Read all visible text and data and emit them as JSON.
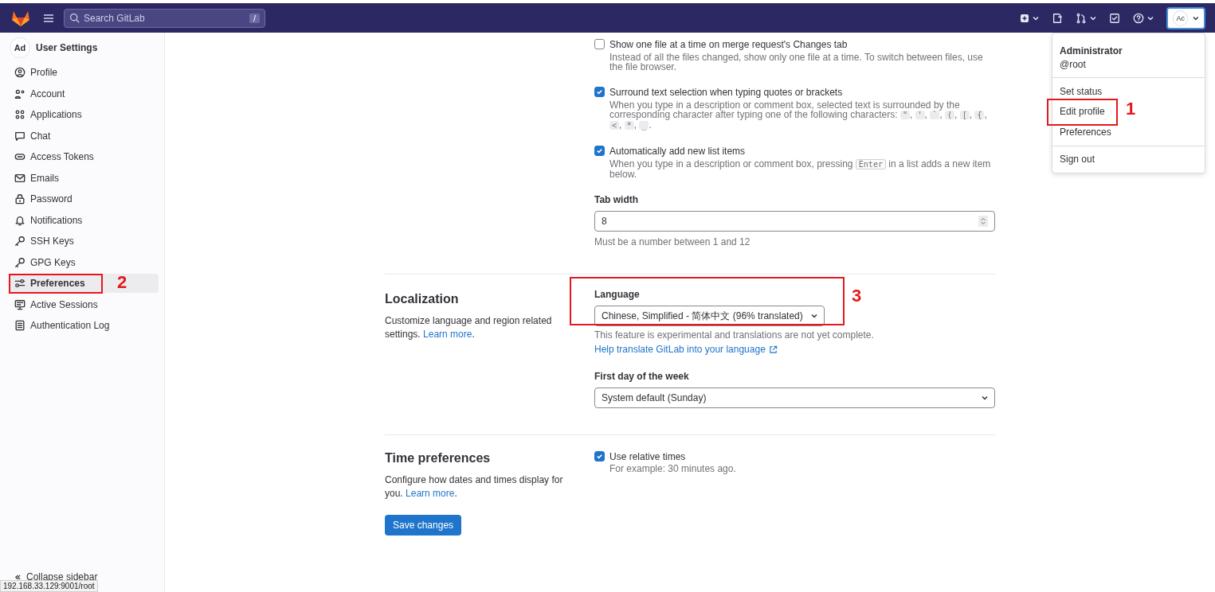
{
  "topbar": {
    "search_placeholder": "Search GitLab",
    "search_key": "/",
    "avatar": "Ac"
  },
  "user_menu": {
    "name": "Administrator",
    "handle": "@root",
    "groups": [
      [
        {
          "label": "Set status"
        },
        {
          "label": "Edit profile",
          "annotation": "1"
        },
        {
          "label": "Preferences"
        }
      ],
      [
        {
          "label": "Sign out"
        }
      ]
    ]
  },
  "sidebar": {
    "avatar": "Ad",
    "title": "User Settings",
    "items": [
      {
        "label": "Profile",
        "kind": "profile",
        "selected": false
      },
      {
        "label": "Account",
        "kind": "account",
        "selected": false
      },
      {
        "label": "Applications",
        "kind": "applications",
        "selected": false
      },
      {
        "label": "Chat",
        "kind": "chat",
        "selected": false
      },
      {
        "label": "Access Tokens",
        "kind": "token",
        "selected": false
      },
      {
        "label": "Emails",
        "kind": "mail",
        "selected": false
      },
      {
        "label": "Password",
        "kind": "lock",
        "selected": false
      },
      {
        "label": "Notifications",
        "kind": "bell",
        "selected": false
      },
      {
        "label": "SSH Keys",
        "kind": "key",
        "selected": false
      },
      {
        "label": "GPG Keys",
        "kind": "key",
        "selected": false
      },
      {
        "label": "Preferences",
        "kind": "preferences",
        "selected": true,
        "annotation": "2"
      },
      {
        "label": "Active Sessions",
        "kind": "monitor",
        "selected": false
      },
      {
        "label": "Authentication Log",
        "kind": "log",
        "selected": false
      }
    ],
    "collapse": "Collapse sidebar"
  },
  "behavior": {
    "options": [
      {
        "label": "Show one file at a time on merge request's Changes tab",
        "checked": false,
        "description": [
          {
            "kind": "text",
            "text": "Instead of all the files changed, show only one file at a time. To switch between files, use the file browser."
          }
        ]
      },
      {
        "label": "Surround text selection when typing quotes or brackets",
        "checked": true,
        "description": [
          {
            "kind": "text",
            "text": "When you type in a description or comment box, selected text is surrounded by the corresponding character after typing one of the following characters: "
          },
          {
            "kind": "code",
            "text": "\""
          },
          {
            "kind": "text",
            "text": ", "
          },
          {
            "kind": "code",
            "text": "'"
          },
          {
            "kind": "text",
            "text": ", "
          },
          {
            "kind": "code",
            "text": "`"
          },
          {
            "kind": "text",
            "text": ", "
          },
          {
            "kind": "code",
            "text": "("
          },
          {
            "kind": "text",
            "text": ", "
          },
          {
            "kind": "code",
            "text": "["
          },
          {
            "kind": "text",
            "text": ", "
          },
          {
            "kind": "code",
            "text": "{"
          },
          {
            "kind": "text",
            "text": ", "
          },
          {
            "kind": "code",
            "text": "<"
          },
          {
            "kind": "text",
            "text": ", "
          },
          {
            "kind": "code",
            "text": "*"
          },
          {
            "kind": "text",
            "text": ", "
          },
          {
            "kind": "code",
            "text": "_"
          },
          {
            "kind": "text",
            "text": "."
          }
        ]
      },
      {
        "label": "Automatically add new list items",
        "checked": true,
        "description": [
          {
            "kind": "text",
            "text": "When you type in a description or comment box, pressing "
          },
          {
            "kind": "code",
            "text": "Enter"
          },
          {
            "kind": "text",
            "text": " in a list adds a new item below."
          }
        ]
      }
    ],
    "tab_width": {
      "label": "Tab width",
      "value": "8",
      "hint": "Must be a number between 1 and 12"
    }
  },
  "localization": {
    "title": "Localization",
    "description": "Customize language and region related settings.",
    "link": "Learn more",
    "link_end": ".",
    "language": {
      "label": "Language",
      "value": "Chinese, Simplified - 简体中文 (96% translated)",
      "annotation": "3",
      "note": "This feature is experimental and translations are not yet complete.",
      "help_link": "Help translate GitLab into your language"
    },
    "first_day": {
      "label": "First day of the week",
      "value": "System default (Sunday)"
    }
  },
  "time": {
    "title": "Time preferences",
    "description": "Configure how dates and times display for you.",
    "link": "Learn more",
    "link_end": ".",
    "option": {
      "label": "Use relative times",
      "checked": true,
      "hint": "For example: 30 minutes ago."
    }
  },
  "save_button": "Save changes",
  "status_url": "192.168.33.129:9001/root"
}
